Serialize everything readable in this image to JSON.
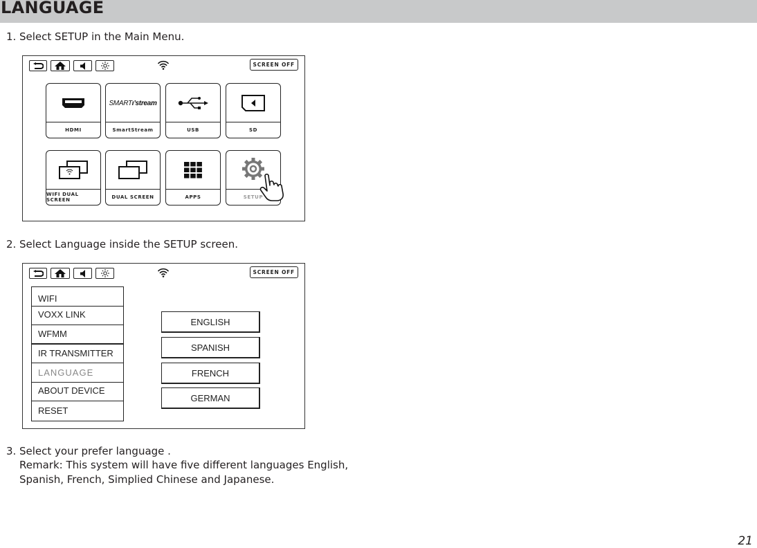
{
  "header": {
    "title": "LANGUAGE"
  },
  "steps": [
    {
      "num": "1.",
      "text": "Select SETUP in the Main Menu."
    },
    {
      "num": "2.",
      "text": "Select Language inside the SETUP screen."
    },
    {
      "num": "3.",
      "text": "Select your prefer language .",
      "remark_line1": "Remark: This system will have five different languages English,",
      "remark_line2": "Spanish, French, Simplied Chinese and Japanese."
    }
  ],
  "main_menu_screen": {
    "topbar": {
      "icons": [
        "back-icon",
        "home-icon",
        "volume-icon",
        "brightness-icon",
        "wifi-icon"
      ],
      "screen_off_label": "SCREEN OFF"
    },
    "tiles": [
      {
        "label": "HDMI",
        "icon": "hdmi-icon"
      },
      {
        "label": "SmartStream",
        "icon": "smartstream-logo",
        "logo_text_a": "SMART",
        "logo_text_b": "ı’stream"
      },
      {
        "label": "USB",
        "icon": "usb-icon"
      },
      {
        "label": "SD",
        "icon": "sd-card-icon"
      },
      {
        "label": "WIFI DUAL SCREEN",
        "icon": "wifi-dual-screen-icon"
      },
      {
        "label": "DUAL SCREEN",
        "icon": "dual-screen-icon"
      },
      {
        "label": "APPS",
        "icon": "apps-grid-icon"
      },
      {
        "label": "SETUP",
        "icon": "gear-icon",
        "selected": true
      }
    ]
  },
  "setup_screen": {
    "topbar": {
      "screen_off_label": "SCREEN OFF"
    },
    "menu_items": [
      "WIFI",
      "VOXX LINK",
      "WFMM",
      "IR TRANSMITTER",
      "LANGUAGE",
      "ABOUT DEVICE",
      "RESET"
    ],
    "active_item": "LANGUAGE",
    "languages": [
      "ENGLISH",
      "SPANISH",
      "FRENCH",
      "GERMAN"
    ]
  },
  "page_number": "21"
}
